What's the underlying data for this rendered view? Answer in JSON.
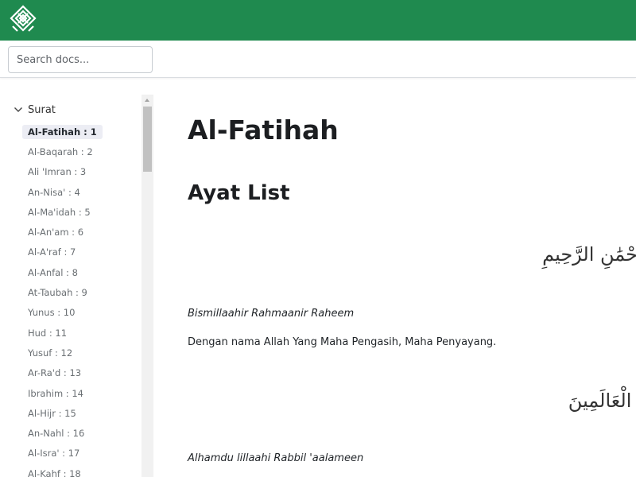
{
  "header": {
    "logo": "calligraphy-logo-icon",
    "background": "#1f8a4f"
  },
  "search": {
    "placeholder": "Search docs..."
  },
  "sidebar": {
    "section_label": "Surat",
    "expanded": true,
    "items": [
      {
        "label": "Al-Fatihah : 1",
        "active": true
      },
      {
        "label": "Al-Baqarah : 2"
      },
      {
        "label": "Ali 'Imran : 3"
      },
      {
        "label": "An-Nisa' : 4"
      },
      {
        "label": "Al-Ma'idah : 5"
      },
      {
        "label": "Al-An'am : 6"
      },
      {
        "label": "Al-A'raf : 7"
      },
      {
        "label": "Al-Anfal : 8"
      },
      {
        "label": "At-Taubah : 9"
      },
      {
        "label": "Yunus : 10"
      },
      {
        "label": "Hud : 11"
      },
      {
        "label": "Yusuf : 12"
      },
      {
        "label": "Ar-Ra'd : 13"
      },
      {
        "label": "Ibrahim : 14"
      },
      {
        "label": "Al-Hijr : 15"
      },
      {
        "label": "An-Nahl : 16"
      },
      {
        "label": "Al-Isra' : 17"
      },
      {
        "label": "Al-Kahf : 18"
      }
    ]
  },
  "main": {
    "title": "Al-Fatihah",
    "section_heading": "Ayat List",
    "ayat": [
      {
        "arabic": "حْمَٰنِ الرَّحِيمِ",
        "transliteration": "Bismillaahir Rahmaanir Raheem",
        "translation": "Dengan nama Allah Yang Maha Pengasih, Maha Penyayang."
      },
      {
        "arabic": "ِّ الْعَالَمِينَ",
        "transliteration": "Alhamdu lillaahi Rabbil 'aalameen",
        "translation": ""
      }
    ]
  }
}
